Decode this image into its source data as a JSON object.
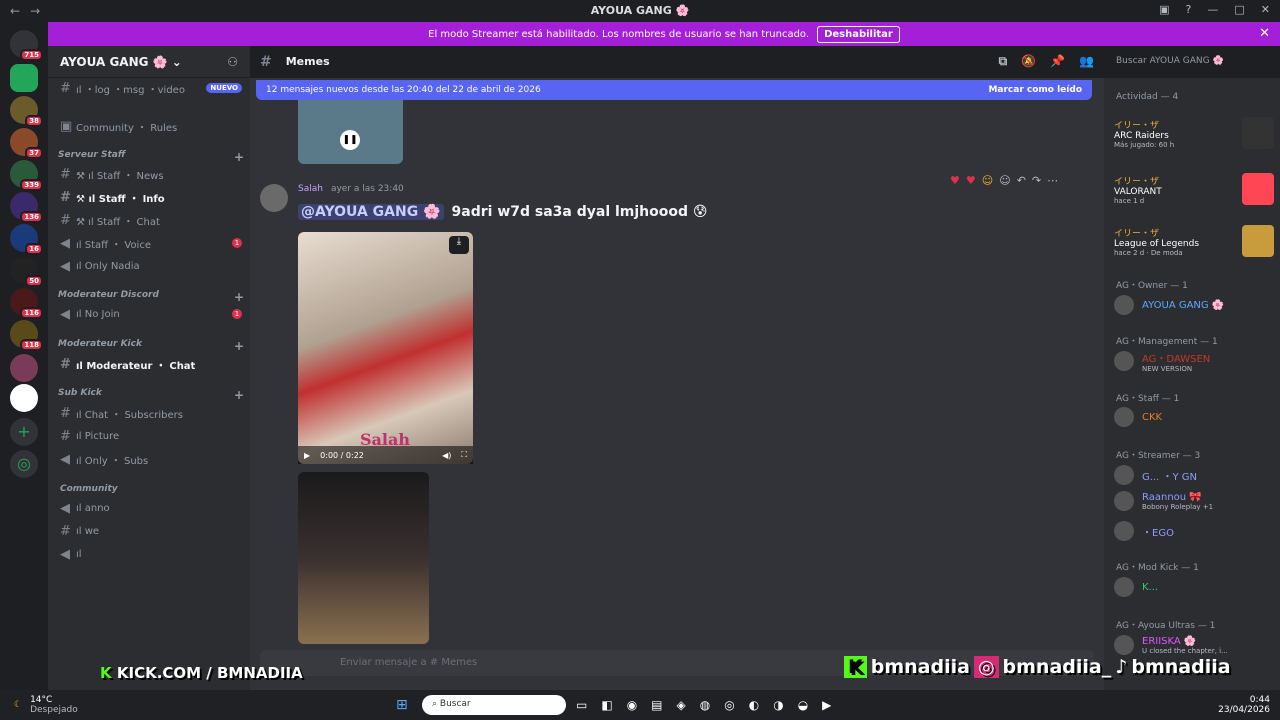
{
  "window": {
    "title": "AYOUA GANG 🌸"
  },
  "banner": {
    "text": "El modo Streamer está habilitado. Los nombres de usuario se han truncado.",
    "button": "Deshabilitar"
  },
  "server_badges": [
    "715",
    "38",
    "37",
    "339",
    "136",
    "16",
    "50",
    "116",
    "118"
  ],
  "guild": {
    "name": "AYOUA GANG 🌸"
  },
  "channels": [
    {
      "label": "ıl ・log ・msg ・video",
      "tag": "NUEVO"
    },
    {
      "label": "Community ・ Rules"
    },
    {
      "category": "Serveur Staff"
    },
    {
      "label": "⚒ ıl Staff ・ News"
    },
    {
      "label": "⚒ ıl Staff ・ Info",
      "active": true
    },
    {
      "label": "⚒ ıl Staff ・ Chat"
    },
    {
      "label": "ıl Staff ・ Voice",
      "count": "1"
    },
    {
      "label": "ıl Only Nadia"
    },
    {
      "category": "Moderateur Discord"
    },
    {
      "label": "ıl No Join",
      "count": "1"
    },
    {
      "category": "Moderateur Kick"
    },
    {
      "label": "ıl Moderateur ・ Chat",
      "active": true
    },
    {
      "category": "Sub Kick"
    },
    {
      "label": "ıl Chat ・ Subscribers"
    },
    {
      "label": "ıl Picture"
    },
    {
      "label": "ıl Only ・ Subs"
    },
    {
      "category": "Community"
    },
    {
      "label": "ıl anno"
    },
    {
      "label": "ıl we"
    },
    {
      "label": "ıl"
    }
  ],
  "header": {
    "channel": "Memes",
    "search": "Buscar AYOUA GANG 🌸"
  },
  "new_messages": {
    "text": "12 mensajes nuevos desde las 20:40 del 22 de abril de 2026",
    "action": "Marcar como leído"
  },
  "message": {
    "author": "Salah",
    "time": "ayer a las 23:40",
    "mention": "@AYOUA GANG 🌸",
    "text": "9adri w7d sa3a dyal lmjhoood 😰",
    "video_time": "0:00 / 0:22",
    "watermark": "Salah"
  },
  "composer": {
    "placeholder": "Enviar mensaje a # Memes"
  },
  "activity": {
    "title": "Actividad — 4",
    "items": [
      {
        "user": "イリー・ザ",
        "game": "ARC Raiders",
        "sub": "Más jugado: 60 h"
      },
      {
        "user": "イリー・ザ",
        "game": "VALORANT",
        "sub": "hace 1 d"
      },
      {
        "user": "イリー・ザ",
        "game": "League of Legends",
        "sub": "hace 2 d · De moda"
      }
    ]
  },
  "roles": [
    {
      "title": "AG・Owner — 1",
      "members": [
        {
          "name": "AYOUA GANG 🌸",
          "color": "#5da8ff"
        }
      ]
    },
    {
      "title": "AG・Management — 1",
      "members": [
        {
          "name": "AG・DAWSEN",
          "sub": "NEW VERSION",
          "color": "#c0392b"
        }
      ]
    },
    {
      "title": "AG・Staff — 1",
      "members": [
        {
          "name": "CKK",
          "color": "#e67e22"
        }
      ]
    },
    {
      "title": "AG・Streamer — 3",
      "members": [
        {
          "name": "G... ・Y GN",
          "color": "#8e9bff"
        },
        {
          "name": "Raannou 🎀",
          "sub": "Bobony Roleplay +1",
          "color": "#8e9bff"
        },
        {
          "name": "・EGO",
          "color": "#8e9bff"
        }
      ]
    },
    {
      "title": "AG・Mod Kick — 1",
      "members": [
        {
          "name": "K...",
          "color": "#2ecc71"
        }
      ]
    },
    {
      "title": "AG・Ayoua Ultras — 1",
      "members": [
        {
          "name": "ERIISKA 🌸",
          "sub": "U closed the chapter, i...",
          "color": "#e056fd"
        }
      ]
    }
  ],
  "overlay": {
    "kick": "KICK.COM / BMNADIIA",
    "social1": "bmnadiia",
    "social2": "bmnadiia_",
    "social3": "bmnadiia"
  },
  "taskbar": {
    "weather": "14°C",
    "weather_sub": "Despejado",
    "search": "Buscar",
    "time": "0:44",
    "date": "23/04/2026"
  }
}
